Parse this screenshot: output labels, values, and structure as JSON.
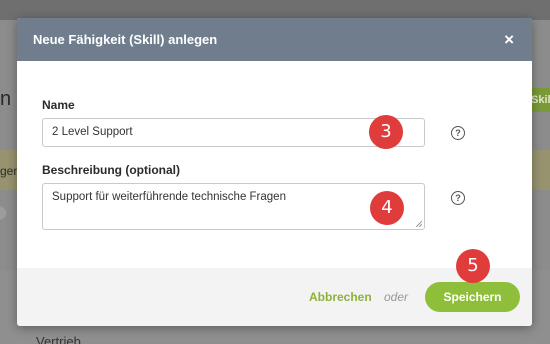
{
  "background": {
    "left_fragment": "n",
    "left_fragment_2": "gen",
    "right_button_fragment": "Skil",
    "bottom_fragment": "Vertrieb"
  },
  "modal": {
    "title": "Neue Fähigkeit (Skill) anlegen",
    "close_icon": "×"
  },
  "form": {
    "name_label": "Name",
    "name_value": "2 Level Support",
    "description_label": "Beschreibung (optional)",
    "description_value": "Support für weiterführende technische Fragen",
    "help_icon": "?"
  },
  "footer": {
    "cancel_label": "Abbrechen",
    "or_text": "oder",
    "save_label": "Speichern"
  },
  "annotations": {
    "step_3": "3",
    "step_4": "4",
    "step_5": "5"
  },
  "colors": {
    "header_bg": "#6f7d8d",
    "accent_green": "#8fbf3a",
    "badge_red": "#e03c3c"
  }
}
